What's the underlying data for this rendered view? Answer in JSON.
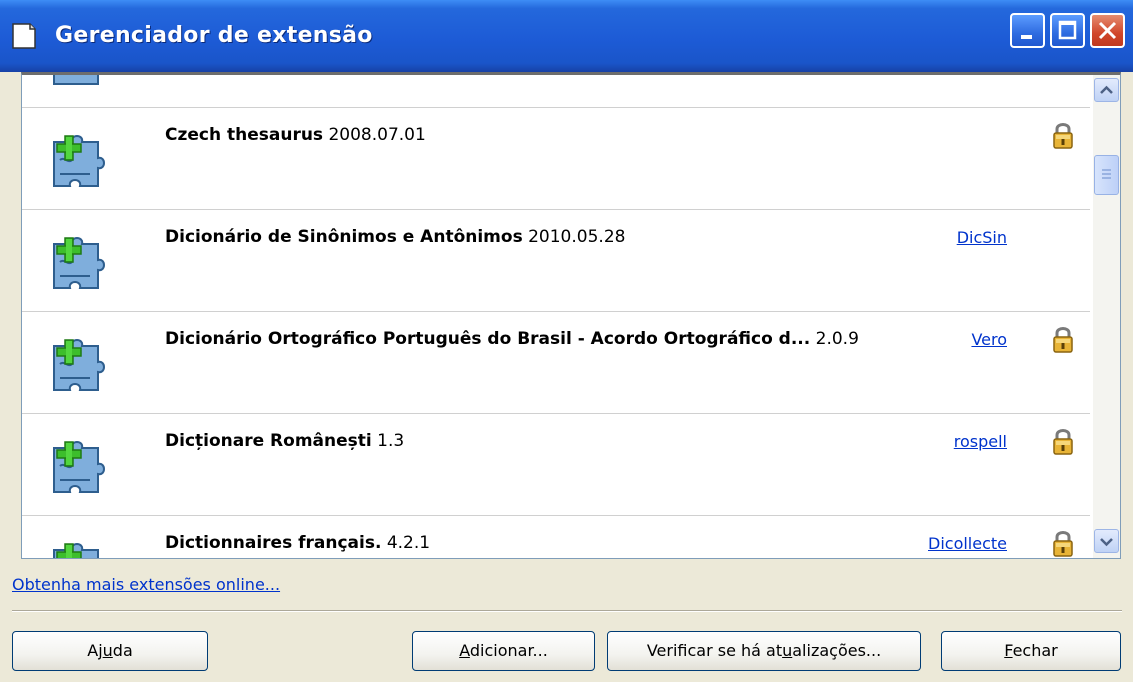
{
  "window": {
    "title": "Gerenciador de extensão",
    "controls": [
      "minimize",
      "maximize",
      "close"
    ]
  },
  "extensions": [
    {
      "name": "Czech thesaurus",
      "version": "2008.07.01",
      "link": "",
      "locked": true
    },
    {
      "name": "Dicionário de Sinônimos e Antônimos",
      "version": "2010.05.28",
      "link": "DicSin",
      "locked": false
    },
    {
      "name": "Dicionário Ortográfico Português do Brasil - Acordo Ortográfico d...",
      "version": "2.0.9",
      "link": "Vero",
      "locked": true
    },
    {
      "name": "Dicționare Românești",
      "version": "1.3",
      "link": "rospell",
      "locked": true
    },
    {
      "name": "Dictionnaires français.",
      "version": "4.2.1",
      "link": "Dicollecte",
      "locked": true
    }
  ],
  "more_link": "Obtenha mais extensões online...",
  "buttons": {
    "help": {
      "prefix": "Aj",
      "mnemonic": "u",
      "suffix": "da"
    },
    "add": {
      "prefix": "",
      "mnemonic": "A",
      "suffix": "dicionar..."
    },
    "updates": {
      "prefix": "Verificar se há at",
      "mnemonic": "u",
      "suffix": "alizações..."
    },
    "close": {
      "prefix": "",
      "mnemonic": "F",
      "suffix": "echar"
    }
  },
  "icons": {
    "extension": "puzzle-extension-icon",
    "lock": "padlock-icon",
    "app": "document-icon"
  },
  "colors": {
    "titlebar": "#1D5BD6",
    "link": "#0033CC",
    "dialog_bg": "#ECE9D8",
    "puzzle_blue": "#7FAEDC",
    "puzzle_green": "#3DBE2C"
  }
}
